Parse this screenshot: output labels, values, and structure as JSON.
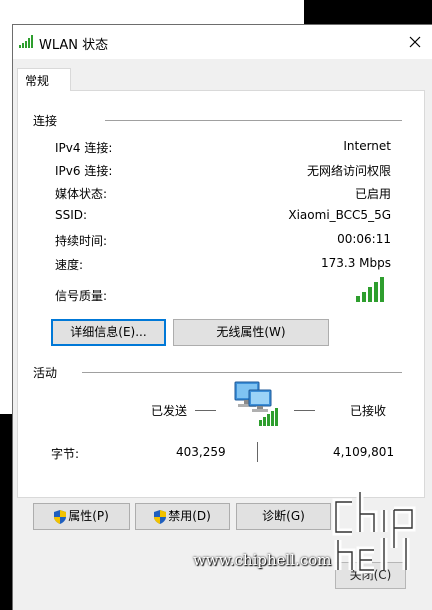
{
  "window": {
    "title": "WLAN 状态",
    "close_glyph": "✕"
  },
  "tabs": [
    {
      "label": "常规"
    }
  ],
  "connection": {
    "heading": "连接",
    "rows": [
      {
        "label": "IPv4 连接:",
        "value": "Internet"
      },
      {
        "label": "IPv6 连接:",
        "value": "无网络访问权限"
      },
      {
        "label": "媒体状态:",
        "value": "已启用"
      },
      {
        "label": "SSID:",
        "value": "Xiaomi_BCC5_5G"
      },
      {
        "label": "持续时间:",
        "value": "00:06:11"
      },
      {
        "label": "速度:",
        "value": "173.3 Mbps"
      }
    ],
    "signal_label": "信号质量:",
    "signal_bars": 5,
    "details_button": "详细信息(E)...",
    "wireless_button": "无线属性(W)"
  },
  "activity": {
    "heading": "活动",
    "sent_label": "已发送",
    "received_label": "已接收",
    "bytes_label": "字节:",
    "bytes_sent": "403,259",
    "bytes_received": "4,109,801"
  },
  "buttons": {
    "properties": "属性(P)",
    "disable": "禁用(D)",
    "diagnose": "诊断(G)",
    "close": "关闭(C)"
  },
  "watermark": {
    "url": "www.chiphell.com"
  },
  "colors": {
    "signal": "#2e9e2e",
    "accent": "#0078d7",
    "shield_blue": "#1f5fbf",
    "shield_yellow": "#f2c200"
  },
  "icons": {
    "title": "wifi-signal-icon",
    "close": "close-icon",
    "network": "network-computers-icon",
    "shield": "uac-shield-icon"
  }
}
